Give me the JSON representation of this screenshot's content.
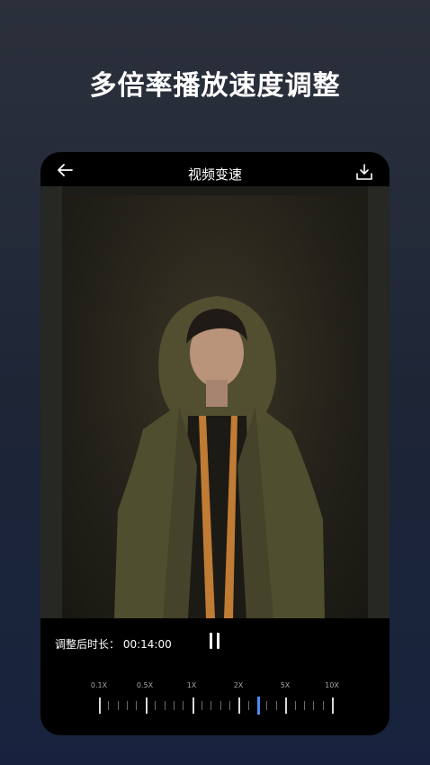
{
  "headline": "多倍率播放速度调整",
  "topbar": {
    "title": "视频变速",
    "back_icon": "back-arrow-icon",
    "download_icon": "download-icon"
  },
  "player": {
    "duration_label": "调整后时长：",
    "duration_value": "00:14:00",
    "state_icon": "pause-icon"
  },
  "speed_slider": {
    "labels": [
      "0.1X",
      "0.5X",
      "1X",
      "2X",
      "5X",
      "10X"
    ],
    "selected_position": "between 2X and 5X",
    "active_color": "#4a8df0"
  }
}
